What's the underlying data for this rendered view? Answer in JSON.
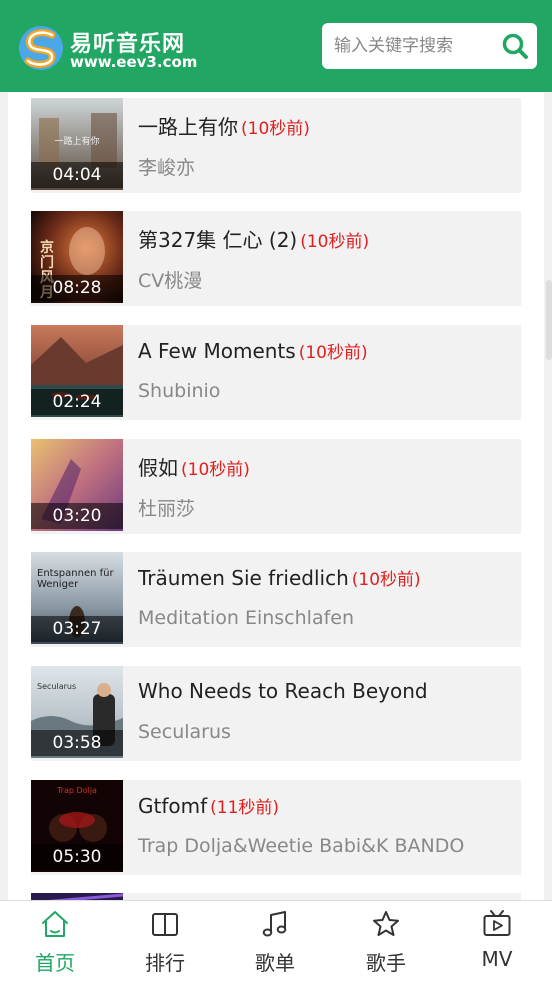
{
  "header": {
    "site_name": "易听音乐网",
    "site_url": "www.eev3.com",
    "brand_color": "#21a663",
    "search": {
      "placeholder": "输入关键字搜索",
      "icon": "search-icon"
    }
  },
  "songs": [
    {
      "title": "一路上有你",
      "ago": "(10秒前)",
      "artist": "李峻亦",
      "duration": "04:04",
      "cover_text": "一路上有你"
    },
    {
      "title": "第327集 仁心 (2)",
      "ago": "(10秒前)",
      "artist": "CV桃漫",
      "duration": "08:28",
      "cover_text": "京门风月"
    },
    {
      "title": "A Few Moments",
      "ago": "(10秒前)",
      "artist": "Shubinio",
      "duration": "02:24",
      "cover_text": ""
    },
    {
      "title": "假如",
      "ago": "(10秒前)",
      "artist": "杜丽莎",
      "duration": "03:20",
      "cover_text": ""
    },
    {
      "title": "Träumen Sie friedlich",
      "ago": "(10秒前)",
      "artist": "Meditation Einschlafen",
      "duration": "03:27",
      "cover_text": "Entspannen für Weniger"
    },
    {
      "title": "Who Needs to Reach Beyond",
      "ago": "",
      "artist": "Secularus",
      "duration": "03:58",
      "cover_text": "Secularus"
    },
    {
      "title": "Gtfomf",
      "ago": "(11秒前)",
      "artist": "Trap Dolja&Weetie Babi&K BANDO",
      "duration": "05:30",
      "cover_text": "Trap Dolja"
    }
  ],
  "nav": [
    {
      "label": "首页",
      "icon": "home-icon",
      "active": true
    },
    {
      "label": "排行",
      "icon": "book-icon",
      "active": false
    },
    {
      "label": "歌单",
      "icon": "music-note-icon",
      "active": false
    },
    {
      "label": "歌手",
      "icon": "star-icon",
      "active": false
    },
    {
      "label": "MV",
      "icon": "tv-play-icon",
      "active": false
    }
  ]
}
